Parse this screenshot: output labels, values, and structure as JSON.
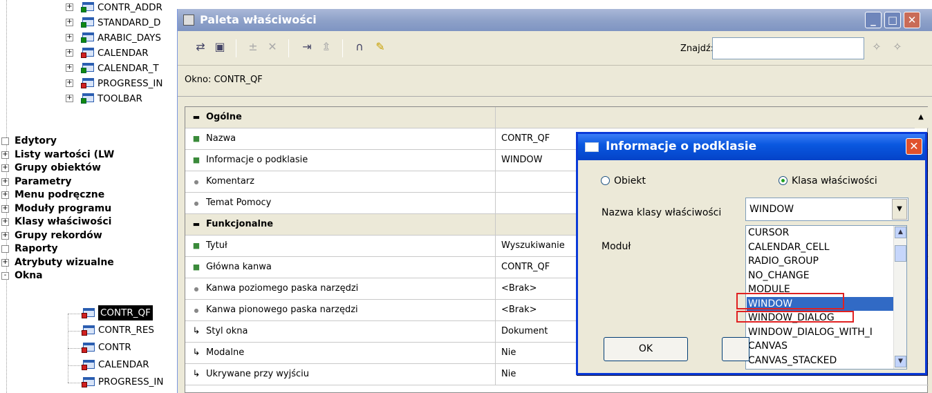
{
  "tree": {
    "items": [
      {
        "label": "CONTR_ADDR"
      },
      {
        "label": "STANDARD_D"
      },
      {
        "label": "ARABIC_DAYS"
      },
      {
        "label": "CALENDAR"
      },
      {
        "label": "CALENDAR_T"
      },
      {
        "label": "PROGRESS_IN"
      },
      {
        "label": "TOOLBAR"
      }
    ],
    "groups": [
      {
        "label": "Edytory",
        "expander": ""
      },
      {
        "label": "Listy wartości (LW",
        "expander": "+"
      },
      {
        "label": "Grupy obiektów",
        "expander": "+"
      },
      {
        "label": "Parametry",
        "expander": "+"
      },
      {
        "label": "Menu podręczne",
        "expander": "+"
      },
      {
        "label": "Moduły programu",
        "expander": "+"
      },
      {
        "label": "Klasy właściwości",
        "expander": "+"
      },
      {
        "label": "Grupy rekordów",
        "expander": "+"
      },
      {
        "label": "Raporty",
        "expander": ""
      },
      {
        "label": "Atrybuty wizualne",
        "expander": "+"
      },
      {
        "label": "Okna",
        "expander": "-"
      }
    ],
    "windows": [
      {
        "label": "CONTR_QF",
        "selected": true
      },
      {
        "label": "CONTR_RES"
      },
      {
        "label": "CONTR"
      },
      {
        "label": "CALENDAR"
      },
      {
        "label": "PROGRESS_IN"
      }
    ]
  },
  "palette": {
    "title": "Paleta właściwości",
    "find_label": "Znajdź:",
    "find_value": "",
    "context": "Okno: CONTR_QF",
    "rows": [
      {
        "kind": "cat",
        "name": "Ogólne",
        "value": ""
      },
      {
        "kind": "sq",
        "name": "Nazwa",
        "value": "CONTR_QF"
      },
      {
        "kind": "sq",
        "name": "Informacje o podklasie",
        "value": "WINDOW"
      },
      {
        "kind": "dot",
        "name": "Komentarz",
        "value": ""
      },
      {
        "kind": "dot",
        "name": "Temat Pomocy",
        "value": ""
      },
      {
        "kind": "cat",
        "name": "Funkcjonalne",
        "value": ""
      },
      {
        "kind": "sq",
        "name": "Tytuł",
        "value": "Wyszukiwanie"
      },
      {
        "kind": "sq",
        "name": "Główna kanwa",
        "value": "CONTR_QF"
      },
      {
        "kind": "dot",
        "name": "Kanwa poziomego paska narzędzi",
        "value": "<Brak>"
      },
      {
        "kind": "dot",
        "name": "Kanwa pionowego paska narzędzi",
        "value": "<Brak>"
      },
      {
        "kind": "arrow",
        "name": "Styl okna",
        "value": "Dokument"
      },
      {
        "kind": "arrow",
        "name": "Modalne",
        "value": "Nie"
      },
      {
        "kind": "arrow",
        "name": "Ukrywane przy wyjściu",
        "value": "Nie"
      }
    ]
  },
  "dialog": {
    "title": "Informacje o podklasie",
    "radio_object": "Obiekt",
    "radio_class": "Klasa właściwości",
    "class_name_label": "Nazwa klasy właściwości",
    "module_label": "Moduł",
    "class_value": "WINDOW",
    "options": [
      "CURSOR",
      "CALENDAR_CELL",
      "RADIO_GROUP",
      "NO_CHANGE",
      "MODULE",
      "WINDOW",
      "WINDOW_DIALOG",
      "WINDOW_DIALOG_WITH_I",
      "CANVAS",
      "CANVAS_STACKED"
    ],
    "selected_option": "WINDOW",
    "ok_label": "OK"
  },
  "colors": {
    "dialog_title": "#0a58e0",
    "selection": "#316ac5",
    "highlight_box": "#e02020"
  }
}
